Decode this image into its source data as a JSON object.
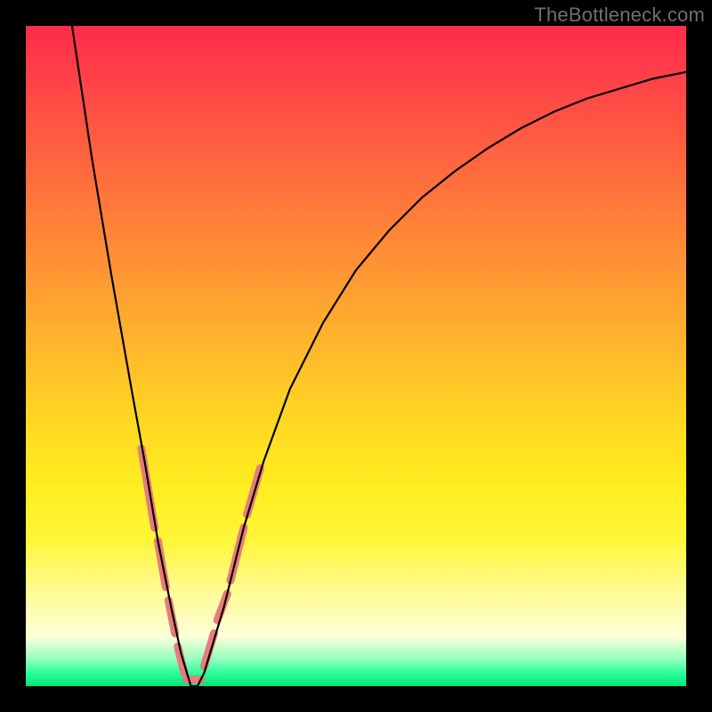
{
  "watermark": "TheBottleneck.com",
  "chart_data": {
    "type": "line",
    "title": "",
    "xlabel": "",
    "ylabel": "",
    "xlim": [
      0,
      100
    ],
    "ylim": [
      0,
      100
    ],
    "grid": false,
    "background_gradient": {
      "orientation": "vertical",
      "stops": [
        {
          "pos": 0.0,
          "color": "#ff2b4a"
        },
        {
          "pos": 0.1,
          "color": "#ff4747"
        },
        {
          "pos": 0.22,
          "color": "#ff6a3e"
        },
        {
          "pos": 0.35,
          "color": "#ff8f35"
        },
        {
          "pos": 0.48,
          "color": "#ffb52c"
        },
        {
          "pos": 0.6,
          "color": "#ffd823"
        },
        {
          "pos": 0.7,
          "color": "#ffee20"
        },
        {
          "pos": 0.78,
          "color": "#fff63a"
        },
        {
          "pos": 0.85,
          "color": "#fffb8c"
        },
        {
          "pos": 0.925,
          "color": "#fdffda"
        },
        {
          "pos": 0.96,
          "color": "#8fffbe"
        },
        {
          "pos": 0.98,
          "color": "#2bff9a"
        },
        {
          "pos": 1.0,
          "color": "#00e676"
        }
      ]
    },
    "series": [
      {
        "name": "bottleneck-curve",
        "color": "#000000",
        "x": [
          7,
          10,
          13,
          16,
          18,
          20,
          22,
          23.5,
          25,
          26,
          27,
          30,
          33,
          36,
          40,
          45,
          50,
          55,
          60,
          65,
          70,
          75,
          80,
          85,
          90,
          95,
          100
        ],
        "y": [
          100,
          80,
          62,
          45,
          34,
          22,
          12,
          5,
          0,
          0,
          2,
          12,
          24,
          34,
          45,
          55,
          63,
          69,
          74,
          78,
          81.5,
          84.5,
          87,
          89,
          90.5,
          92,
          93
        ]
      }
    ],
    "markers": [
      {
        "name": "highlight-dashes",
        "color": "#e97b7b",
        "stroke_width": 9,
        "segments": [
          {
            "x1": 17.5,
            "y1": 36,
            "x2": 19.5,
            "y2": 24
          },
          {
            "x1": 20.0,
            "y1": 22,
            "x2": 21.2,
            "y2": 15
          },
          {
            "x1": 21.6,
            "y1": 13,
            "x2": 22.6,
            "y2": 8
          },
          {
            "x1": 23.0,
            "y1": 6,
            "x2": 24.0,
            "y2": 2
          },
          {
            "x1": 24.3,
            "y1": 1,
            "x2": 26.5,
            "y2": 1
          },
          {
            "x1": 27.0,
            "y1": 3,
            "x2": 28.5,
            "y2": 8
          },
          {
            "x1": 29.0,
            "y1": 10,
            "x2": 30.5,
            "y2": 14
          },
          {
            "x1": 31.0,
            "y1": 16,
            "x2": 33.0,
            "y2": 24
          },
          {
            "x1": 33.5,
            "y1": 26,
            "x2": 35.5,
            "y2": 33
          }
        ]
      }
    ]
  }
}
